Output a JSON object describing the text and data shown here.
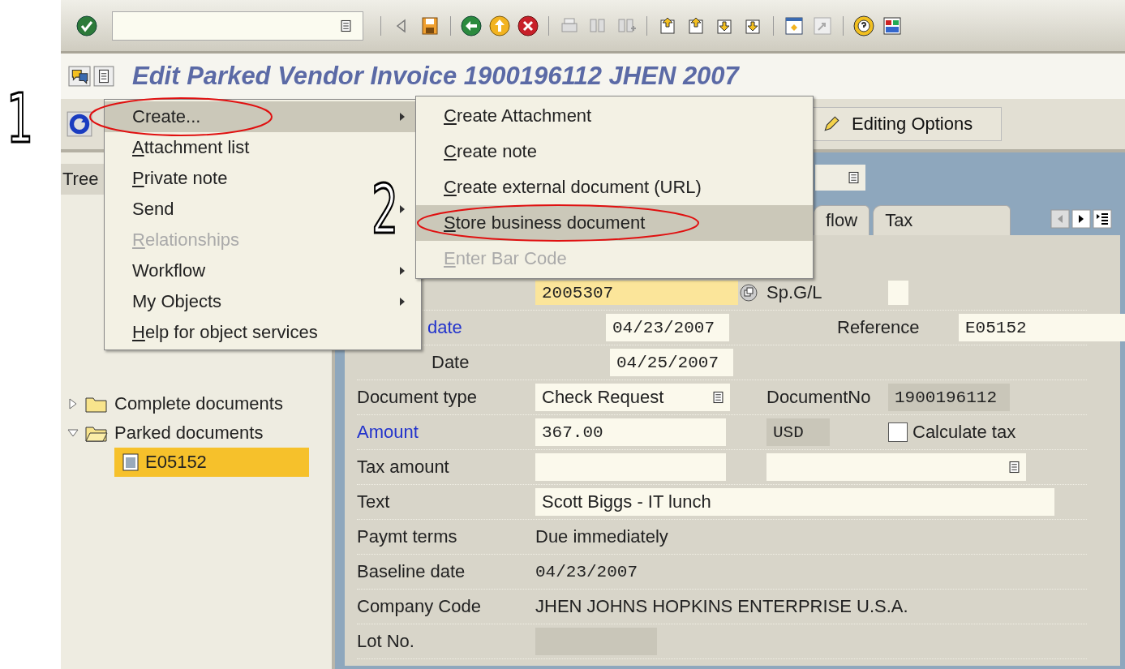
{
  "title": "Edit Parked Vendor Invoice 1900196112 JHEN 2007",
  "app_toolbar": {
    "buttons": [
      {
        "label": "Editing Options"
      }
    ]
  },
  "tree": {
    "header": "Tree",
    "items": [
      {
        "label": "Complete documents",
        "expanded": false,
        "selected": false
      },
      {
        "label": "Parked documents",
        "expanded": true,
        "selected": false,
        "children": [
          {
            "label": "E05152",
            "selected": true
          }
        ]
      }
    ]
  },
  "tabs": [
    {
      "label": "flow",
      "selected": false
    },
    {
      "label": "Tax",
      "selected": false
    }
  ],
  "form": {
    "rows": [
      {
        "value": {
          "kind": "focused",
          "text": "2005307",
          "search_help": true
        },
        "label2": {
          "kind": "label",
          "text": "Sp.G/L",
          "link": false
        },
        "value2": {
          "kind": "field"
        }
      },
      {
        "label": {
          "kind": "label",
          "text": "date",
          "link": true
        },
        "value": {
          "kind": "field",
          "text": "04/23/2007"
        },
        "label2": {
          "kind": "label",
          "text": "Reference",
          "link": false
        },
        "value2": {
          "kind": "field",
          "text": "E05152"
        }
      },
      {
        "label": {
          "kind": "label",
          "text": "Date",
          "link": false
        },
        "value": {
          "kind": "field",
          "text": "04/25/2007"
        }
      },
      {
        "label": {
          "kind": "label",
          "text": "Document type",
          "link": false
        },
        "value": {
          "kind": "field",
          "text": "Check Request",
          "dropdown": true
        },
        "label2": {
          "kind": "label",
          "text": "DocumentNo",
          "link": false
        },
        "value2": {
          "kind": "readonly",
          "text": "1900196112"
        }
      },
      {
        "label": {
          "kind": "label",
          "text": "Amount",
          "link": true
        },
        "value": {
          "kind": "field",
          "text": "367.00"
        },
        "label2": {
          "kind": "readonly",
          "text": "USD"
        },
        "value2": {
          "kind": "checkbox",
          "text": "Calculate tax",
          "checked": false
        }
      },
      {
        "label": {
          "kind": "label",
          "text": "Tax amount",
          "link": false
        },
        "value": {
          "kind": "field"
        },
        "label2": {
          "kind": "field",
          "dropdown": true
        }
      },
      {
        "label": {
          "kind": "label",
          "text": "Text",
          "link": false
        },
        "value": {
          "kind": "field",
          "text": "Scott Biggs - IT lunch"
        }
      },
      {
        "label": {
          "kind": "label",
          "text": "Paymt terms",
          "link": false
        },
        "value": {
          "kind": "text",
          "text": "Due immediately"
        }
      },
      {
        "label": {
          "kind": "label",
          "text": "Baseline date",
          "link": false
        },
        "value": {
          "kind": "text",
          "text": "04/23/2007"
        }
      },
      {
        "label": {
          "kind": "label",
          "text": "Company Code",
          "link": false
        },
        "value": {
          "kind": "text",
          "text": "JHEN JOHNS HOPKINS ENTERPRISE U.S.A."
        }
      },
      {
        "label": {
          "kind": "label",
          "text": "Lot No.",
          "link": false
        },
        "value": {
          "kind": "readonly"
        }
      }
    ]
  },
  "menu": {
    "items": [
      {
        "label": "Create...",
        "selected": true,
        "disabled": false,
        "submenu": true,
        "mnemonic": false,
        "circled": true
      },
      {
        "label": "Attachment list",
        "selected": false,
        "disabled": false,
        "submenu": false,
        "mnemonic": true,
        "circled": false
      },
      {
        "label": "Private note",
        "selected": false,
        "disabled": false,
        "submenu": false,
        "mnemonic": true,
        "circled": false
      },
      {
        "label": "Send",
        "selected": false,
        "disabled": false,
        "submenu": true,
        "mnemonic": false,
        "circled": false
      },
      {
        "label": "Relationships",
        "selected": false,
        "disabled": true,
        "submenu": false,
        "mnemonic": true,
        "circled": false
      },
      {
        "label": "Workflow",
        "selected": false,
        "disabled": false,
        "submenu": true,
        "mnemonic": false,
        "circled": false
      },
      {
        "label": "My Objects",
        "selected": false,
        "disabled": false,
        "submenu": true,
        "mnemonic": false,
        "circled": false
      },
      {
        "label": "Help for object services",
        "selected": false,
        "disabled": false,
        "submenu": false,
        "mnemonic": true,
        "circled": false
      }
    ]
  },
  "submenu": {
    "items": [
      {
        "label": "Create Attachment",
        "selected": false,
        "disabled": false,
        "mnemonic": true,
        "circled": false
      },
      {
        "label": "Create note",
        "selected": false,
        "disabled": false,
        "mnemonic": true,
        "circled": false
      },
      {
        "label": "Create external document (URL)",
        "selected": false,
        "disabled": false,
        "mnemonic": true,
        "circled": false
      },
      {
        "label": "Store business document",
        "selected": true,
        "disabled": false,
        "mnemonic": true,
        "circled": true
      },
      {
        "label": "Enter Bar Code",
        "selected": false,
        "disabled": true,
        "mnemonic": true,
        "circled": false
      }
    ]
  },
  "annotations": [
    {
      "label": "1"
    },
    {
      "label": "2"
    }
  ]
}
